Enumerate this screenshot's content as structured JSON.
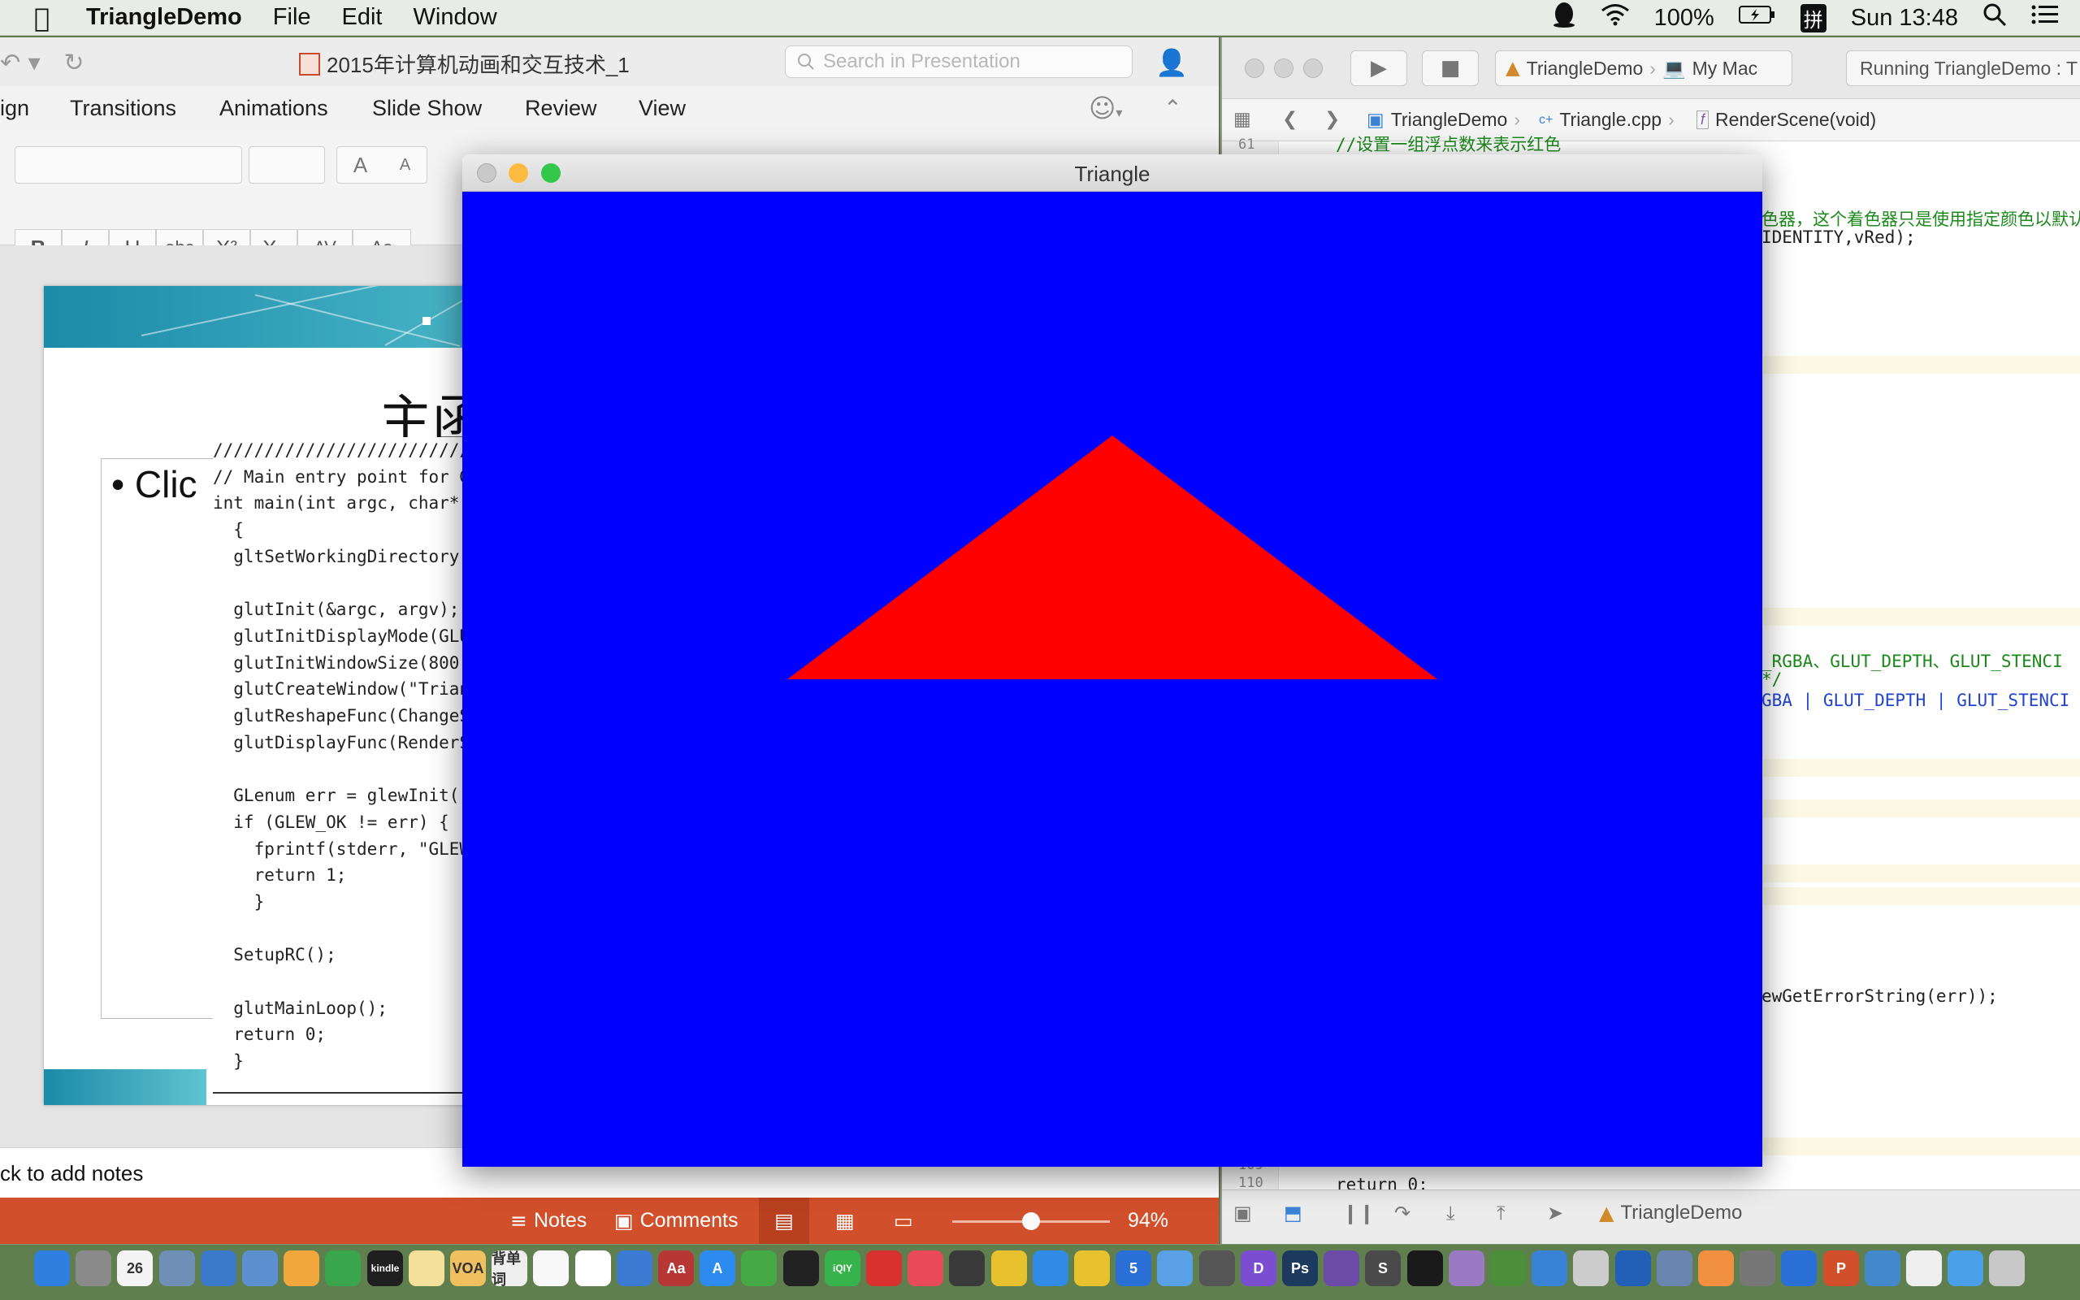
{
  "menubar": {
    "app_name": "TriangleDemo",
    "menus": [
      "File",
      "Edit",
      "Window"
    ],
    "battery": "100%",
    "input_method": "拼",
    "clock": "Sun 13:48"
  },
  "powerpoint": {
    "doc_title": "2015年计算机动画和交互技术_1",
    "search_placeholder": "Search in Presentation",
    "tabs": [
      "ign",
      "Transitions",
      "Animations",
      "Slide Show",
      "Review",
      "View"
    ],
    "format_buttons": [
      "B",
      "I",
      "U",
      "abc",
      "X²",
      "X₂",
      "AV",
      "Aa"
    ],
    "font_grow": "A",
    "font_shrink": "A",
    "slide_title": "主函",
    "bullet_text": "Clic",
    "code_lines": [
      "//////////////////////////////",
      "// Main entry point for G",
      "int main(int argc, char*",
      "  {",
      "  gltSetWorkingDirectory(",
      "",
      "  glutInit(&argc, argv);",
      "  glutInitDisplayMode(GLU",
      "  glutInitWindowSize(800,",
      "  glutCreateWindow(\"Trian",
      "  glutReshapeFunc(ChangeS",
      "  glutDisplayFunc(RenderS",
      "",
      "  GLenum err = glewInit()",
      "  if (GLEW_OK != err) {",
      "    fprintf(stderr, \"GLEW",
      "    return 1;",
      "    }",
      "",
      "  SetupRC();",
      "",
      "  glutMainLoop();",
      "  return 0;",
      "  }"
    ],
    "notes_placeholder": "ck to add notes",
    "status": {
      "notes": "Notes",
      "comments": "Comments",
      "zoom": "94%"
    }
  },
  "xcode": {
    "scheme": "TriangleDemo",
    "destination": "My Mac",
    "run_status": "Running TriangleDemo : T",
    "jump_bar": [
      "TriangleDemo",
      "Triangle.cpp",
      "RenderScene(void)"
    ],
    "line_numbers": {
      "top": "61",
      "bottom_a": "109",
      "bottom_b": "110"
    },
    "code_fragments": [
      {
        "text": "//设置一组浮点数来表示红色",
        "color": "#1b8a1b"
      },
      {
        "text": "色器，这个着色器只是使用指定颜色以默认",
        "color": "#1b8a1b"
      },
      {
        "text": "IDENTITY,vRed);",
        "color": "#222222"
      },
      {
        "text": "_RGBA、GLUT_DEPTH、GLUT_STENCI",
        "color": "#1b8a1b"
      },
      {
        "text": "*/",
        "color": "#1b8a1b"
      },
      {
        "text": "GBA | GLUT_DEPTH | GLUT_STENCI",
        "color": "#2244cc"
      },
      {
        "text": "ewGetErrorString(err));",
        "color": "#222222"
      },
      {
        "text": "return 0;",
        "color": "#222222"
      }
    ],
    "debug_target": "TriangleDemo"
  },
  "triangle_window": {
    "title": "Triangle",
    "background": "#0000ff",
    "triangle_color": "#ff0000",
    "traffic": {
      "close": "#c9c9c9",
      "minimize": "#fdbc40",
      "zoom": "#34c84a"
    }
  },
  "dock": {
    "date_day": "26",
    "apps": [
      {
        "name": "finder",
        "color": "#2f7fe0",
        "label": ""
      },
      {
        "name": "launchpad",
        "color": "#8a8a8a",
        "label": ""
      },
      {
        "name": "calendar",
        "color": "#f4f4f4",
        "label": "26"
      },
      {
        "name": "preview",
        "color": "#6f8fb6",
        "label": ""
      },
      {
        "name": "keynote",
        "color": "#3a78c9",
        "label": ""
      },
      {
        "name": "safari-alt",
        "color": "#5b8fd0",
        "label": ""
      },
      {
        "name": "pages",
        "color": "#f1a73b",
        "label": ""
      },
      {
        "name": "numbers",
        "color": "#39a54d",
        "label": ""
      },
      {
        "name": "kindle",
        "color": "#1f1f1f",
        "label": "kindle"
      },
      {
        "name": "notes",
        "color": "#f5e09a",
        "label": ""
      },
      {
        "name": "voa",
        "color": "#f0c060",
        "label": "VOA"
      },
      {
        "name": "dictionary",
        "color": "#eeeeee",
        "label": "背单词"
      },
      {
        "name": "textedit",
        "color": "#f8f8f8",
        "label": ""
      },
      {
        "name": "news",
        "color": "#ffffff",
        "label": ""
      },
      {
        "name": "system-info",
        "color": "#3b7bd4",
        "label": ""
      },
      {
        "name": "dictionary-aa",
        "color": "#b73737",
        "label": "Aa"
      },
      {
        "name": "app-store",
        "color": "#2d8bef",
        "label": "A"
      },
      {
        "name": "evernote",
        "color": "#45a945",
        "label": ""
      },
      {
        "name": "qq",
        "color": "#222222",
        "label": ""
      },
      {
        "name": "iqiyi",
        "color": "#36b34a",
        "label": "iQIY"
      },
      {
        "name": "video-player",
        "color": "#d93030",
        "label": ""
      },
      {
        "name": "music",
        "color": "#e94a5a",
        "label": ""
      },
      {
        "name": "speaker",
        "color": "#3a3a3a",
        "label": ""
      },
      {
        "name": "banana",
        "color": "#e7c22e",
        "label": ""
      },
      {
        "name": "safari",
        "color": "#2f8be6",
        "label": ""
      },
      {
        "name": "chrome",
        "color": "#e7c22e",
        "label": ""
      },
      {
        "name": "5-app",
        "color": "#2a6fd6",
        "label": "5"
      },
      {
        "name": "feather",
        "color": "#5aa0e6",
        "label": ""
      },
      {
        "name": "alfred",
        "color": "#555555",
        "label": ""
      },
      {
        "name": "dash",
        "color": "#7b4dd1",
        "label": "D"
      },
      {
        "name": "photoshop",
        "color": "#1c3a5e",
        "label": "Ps"
      },
      {
        "name": "github",
        "color": "#6b4aa8",
        "label": ""
      },
      {
        "name": "sublime",
        "color": "#4a4a4a",
        "label": "S"
      },
      {
        "name": "terminal",
        "color": "#1a1a1a",
        "label": ""
      },
      {
        "name": "disk",
        "color": "#9a7ac2",
        "label": ""
      },
      {
        "name": "instruments",
        "color": "#4b8f3a",
        "label": ""
      },
      {
        "name": "xcode",
        "color": "#3a82d6",
        "label": ""
      },
      {
        "name": "cocoapods",
        "color": "#cccccc",
        "label": ""
      },
      {
        "name": "sourcetree",
        "color": "#2260b8",
        "label": ""
      },
      {
        "name": "camera",
        "color": "#6a86b0",
        "label": ""
      },
      {
        "name": "color-picker",
        "color": "#f09040",
        "label": ""
      },
      {
        "name": "system-preferences",
        "color": "#777777",
        "label": ""
      },
      {
        "name": "shield",
        "color": "#2a6fd6",
        "label": ""
      },
      {
        "name": "powerpoint",
        "color": "#d24f2b",
        "label": "P"
      },
      {
        "name": "screens",
        "color": "#4488cc",
        "label": ""
      },
      {
        "name": "preview-doc",
        "color": "#eeeeee",
        "label": ""
      },
      {
        "name": "folder",
        "color": "#4aa0e8",
        "label": ""
      },
      {
        "name": "trash",
        "color": "#c8c8c8",
        "label": ""
      }
    ]
  }
}
